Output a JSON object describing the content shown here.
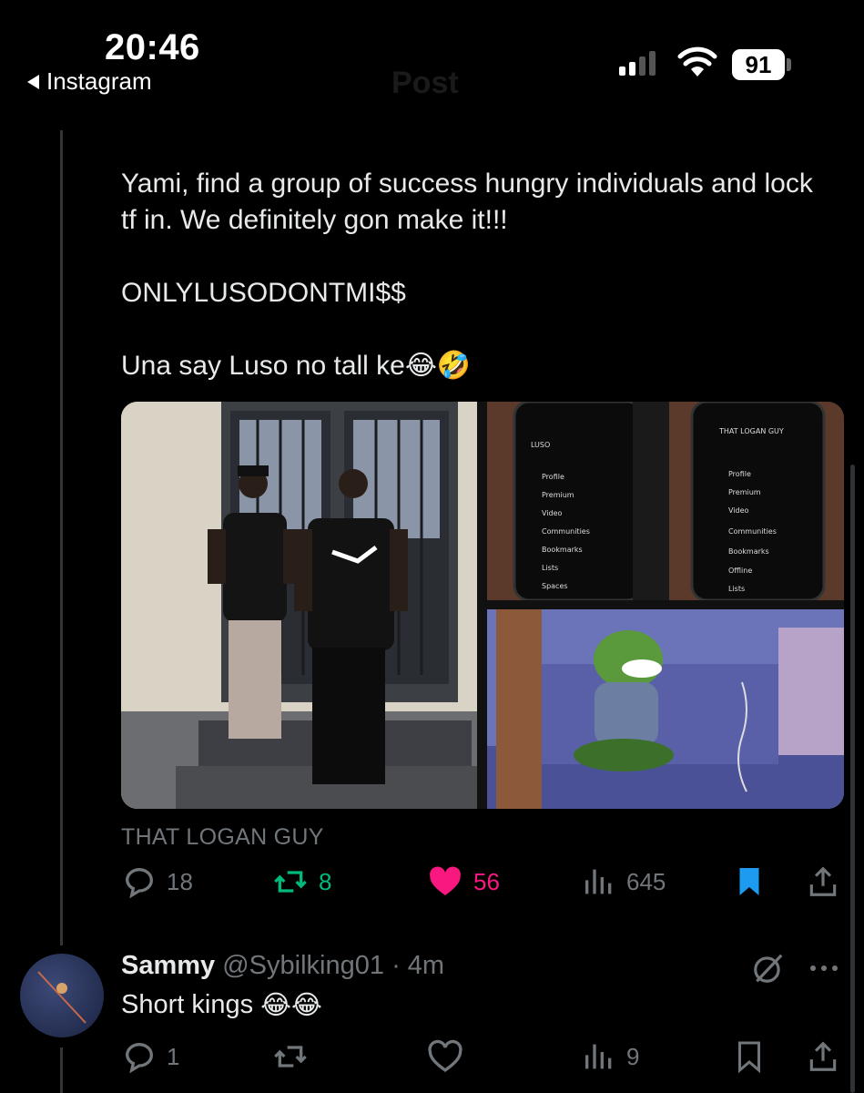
{
  "status_bar": {
    "time": "20:46",
    "back_app": "Instagram",
    "battery": "91",
    "header_ghost": "Post"
  },
  "quoted_tweet": {
    "lines": [
      "Yami, find a group of success hungry individuals and lock tf in. We definitely gon make it!!!",
      "ONLYLUSODONTMI$$",
      "Una say Luso no tall ke"
    ],
    "emoji_suffix": "😂🤣",
    "media": [
      {
        "name": "photo-two-men"
      },
      {
        "name": "photo-phone-screens",
        "left_phone": {
          "handle": "LUSO",
          "menu": [
            "Profile",
            "Premium",
            "Video",
            "Communities",
            "Bookmarks",
            "Lists",
            "Spaces"
          ]
        },
        "right_phone": {
          "handle": "THAT LOGAN GUY",
          "menu": [
            "Profile",
            "Premium",
            "Video",
            "Communities",
            "Bookmarks",
            "Offline",
            "Lists"
          ]
        }
      },
      {
        "name": "photo-pepe-meme"
      }
    ],
    "caption": "THAT LOGAN GUY",
    "stats": {
      "replies": "18",
      "reposts": "8",
      "likes": "56",
      "views": "645"
    },
    "colors": {
      "repost": "#00ba7c",
      "like": "#f91880",
      "bookmark": "#1d9bf0",
      "muted": "#71767b"
    }
  },
  "reply": {
    "name": "Sammy",
    "handle": "@Sybilking01",
    "time": "· 4m",
    "text": "Short kings",
    "emoji": "😂😂",
    "stats": {
      "replies": "1",
      "views": "9"
    }
  }
}
